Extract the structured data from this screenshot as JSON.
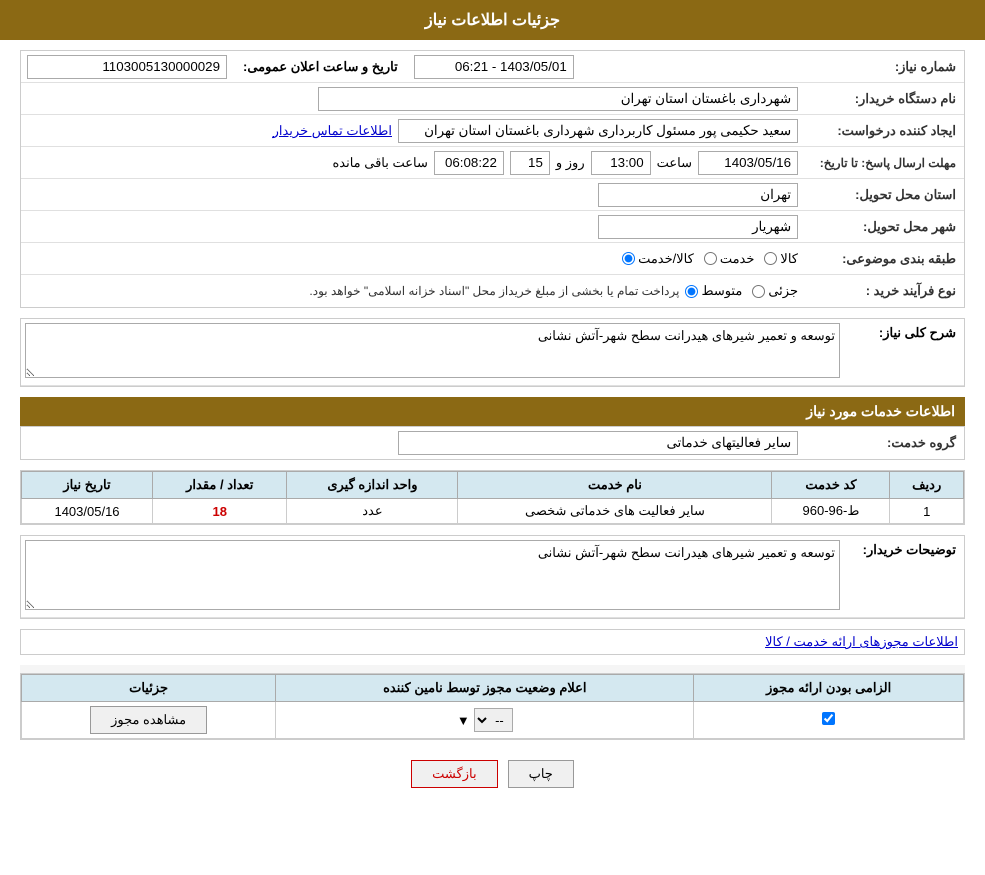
{
  "header": {
    "title": "جزئیات اطلاعات نیاز"
  },
  "fields": {
    "need_number_label": "شماره نیاز:",
    "need_number_value": "1103005130000029",
    "announcement_date_label": "تاریخ و ساعت اعلان عمومی:",
    "announcement_date_value": "1403/05/01 - 06:21",
    "buyer_org_label": "نام دستگاه خریدار:",
    "buyer_org_value": "شهرداری باغستان استان تهران",
    "creator_label": "ایجاد کننده درخواست:",
    "creator_value": "سعید حکیمی پور مسئول کاربرداری شهرداری باغستان استان تهران",
    "contact_link": "اطلاعات تماس خریدار",
    "response_deadline_label": "مهلت ارسال پاسخ: تا تاریخ:",
    "response_date": "1403/05/16",
    "response_time_label": "ساعت",
    "response_time": "13:00",
    "response_day_label": "روز و",
    "response_days": "15",
    "response_remaining_label": "ساعت باقی مانده",
    "response_remaining": "06:08:22",
    "delivery_province_label": "استان محل تحویل:",
    "delivery_province_value": "تهران",
    "delivery_city_label": "شهر محل تحویل:",
    "delivery_city_value": "شهریار",
    "category_label": "طبقه بندی موضوعی:",
    "category_kala": "کالا",
    "category_khadamat": "خدمت",
    "category_kala_khadamat": "کالا/خدمت",
    "purchase_type_label": "نوع فرآیند خرید :",
    "purchase_type_jazee": "جزئی",
    "purchase_type_mootavaset": "متوسط",
    "purchase_type_note": "پرداخت تمام یا بخشی از مبلغ خریداز محل \"اسناد خزانه اسلامی\" خواهد بود.",
    "need_description_label": "شرح کلی نیاز:",
    "need_description_value": "توسعه و تعمیر شیرهای هیدرانت سطح شهر-آتش نشانی",
    "services_section_title": "اطلاعات خدمات مورد نیاز",
    "service_group_label": "گروه خدمت:",
    "service_group_value": "سایر فعالیتهای خدماتی",
    "table": {
      "headers": [
        "ردیف",
        "کد خدمت",
        "نام خدمت",
        "واحد اندازه گیری",
        "تعداد / مقدار",
        "تاریخ نیاز"
      ],
      "rows": [
        {
          "row": "1",
          "code": "ط-96-960",
          "name": "سایر فعالیت های خدماتی شخصی",
          "unit": "عدد",
          "quantity": "18",
          "date": "1403/05/16"
        }
      ]
    },
    "buyer_description_label": "توضیحات خریدار:",
    "buyer_description_value": "توسعه و تعمیر شیرهای هیدرانت سطح شهر-آتش نشانی",
    "permits_section_title": "اطلاعات مجوزهای ارائه خدمت / کالا",
    "permits_table": {
      "headers": [
        "الزامی بودن ارائه مجوز",
        "اعلام وضعیت مجوز توسط نامین کننده",
        "جزئیات"
      ],
      "rows": [
        {
          "required": true,
          "status_value": "--",
          "details_label": "مشاهده مجوز"
        }
      ]
    }
  },
  "buttons": {
    "print": "چاپ",
    "back": "بازگشت"
  }
}
